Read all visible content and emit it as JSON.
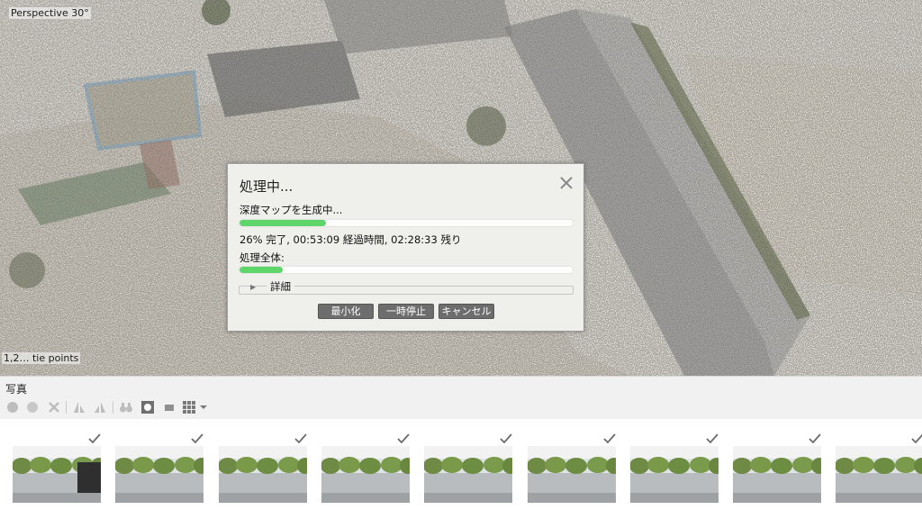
{
  "viewport": {
    "title": "Perspective 30°",
    "points_label": "1,2… tie points"
  },
  "dialog": {
    "title": "処理中...",
    "close_icon": "close-icon",
    "task_label": "深度マップを生成中...",
    "task_progress": 0.26,
    "stats_text": "26% 完了, 00:53:09 経過時間, 02:28:33 残り",
    "overall_label": "処理全体:",
    "overall_progress": 0.13,
    "details_label": "詳細",
    "buttons": {
      "minimize": "最小化",
      "pause": "一時停止",
      "cancel": "キャンセル"
    },
    "progress_color": "#5fd66a"
  },
  "photos": {
    "title": "写真",
    "toolbar_icons": [
      "enable-icon",
      "disable-icon",
      "remove-icon",
      "rotate-left-icon",
      "rotate-right-icon",
      "binoculars-icon",
      "mask-icon",
      "small-thumbnails-icon",
      "grid-view-icon",
      "view-dropdown-icon"
    ],
    "thumbnails": [
      {
        "aligned": true
      },
      {
        "aligned": true
      },
      {
        "aligned": true
      },
      {
        "aligned": true
      },
      {
        "aligned": true
      },
      {
        "aligned": true
      },
      {
        "aligned": true
      },
      {
        "aligned": true
      },
      {
        "aligned": true
      }
    ]
  }
}
